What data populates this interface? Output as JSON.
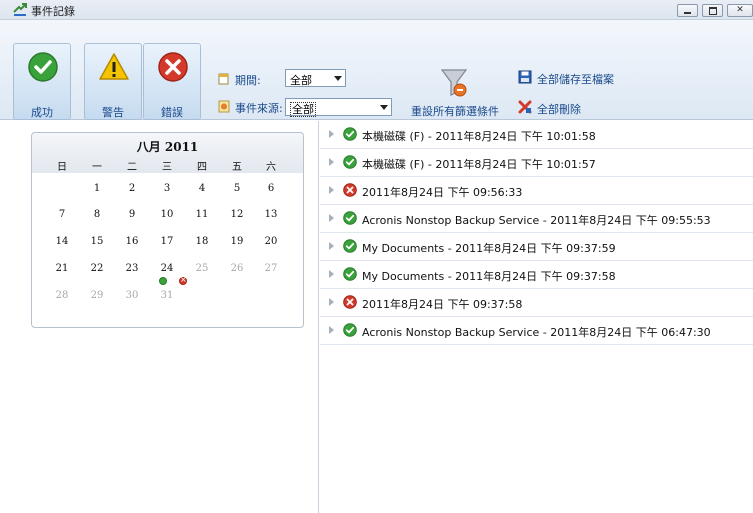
{
  "window": {
    "title": "事件記錄",
    "min_icon": "minimize-icon",
    "max_icon": "maximize-icon",
    "close_label": "✕"
  },
  "toolbar": {
    "success_label": "成功",
    "warning_label": "警告",
    "error_label": "錯誤",
    "period_label": "期間:",
    "period_value": "全部",
    "source_label": "事件來源:",
    "source_value": "全部",
    "reset_label": "重設所有篩選條件",
    "save_all_label": "全部儲存至檔案",
    "delete_all_label": "全部刪除"
  },
  "calendar": {
    "title": "八月 2011",
    "weekdays": [
      "日",
      "一",
      "二",
      "三",
      "四",
      "五",
      "六"
    ],
    "weeks": [
      [
        "",
        "1",
        "2",
        "3",
        "4",
        "5",
        "6"
      ],
      [
        "7",
        "8",
        "9",
        "10",
        "11",
        "12",
        "13"
      ],
      [
        "14",
        "15",
        "16",
        "17",
        "18",
        "19",
        "20"
      ],
      [
        "21",
        "22",
        "23",
        "24",
        "25",
        "26",
        "27"
      ],
      [
        "28",
        "29",
        "30",
        "31",
        "",
        "",
        ""
      ]
    ]
  },
  "events": [
    {
      "status": "success",
      "text": "本機磁碟 (F) - 2011年8月24日 下午 10:01:58"
    },
    {
      "status": "success",
      "text": "本機磁碟 (F) - 2011年8月24日 下午 10:01:57"
    },
    {
      "status": "error",
      "text": "2011年8月24日 下午 09:56:33"
    },
    {
      "status": "success",
      "text": "Acronis Nonstop Backup Service - 2011年8月24日 下午 09:55:53"
    },
    {
      "status": "success",
      "text": "My Documents - 2011年8月24日 下午 09:37:59"
    },
    {
      "status": "success",
      "text": "My Documents - 2011年8月24日 下午 09:37:58"
    },
    {
      "status": "error",
      "text": "2011年8月24日 下午 09:37:58"
    },
    {
      "status": "success",
      "text": "Acronis Nonstop Backup Service - 2011年8月24日 下午 06:47:30"
    }
  ],
  "colors": {
    "link_blue": "#1b4a8c",
    "success_green": "#3aa23a",
    "error_red": "#d33a2c",
    "warning_yellow": "#f5c400"
  }
}
